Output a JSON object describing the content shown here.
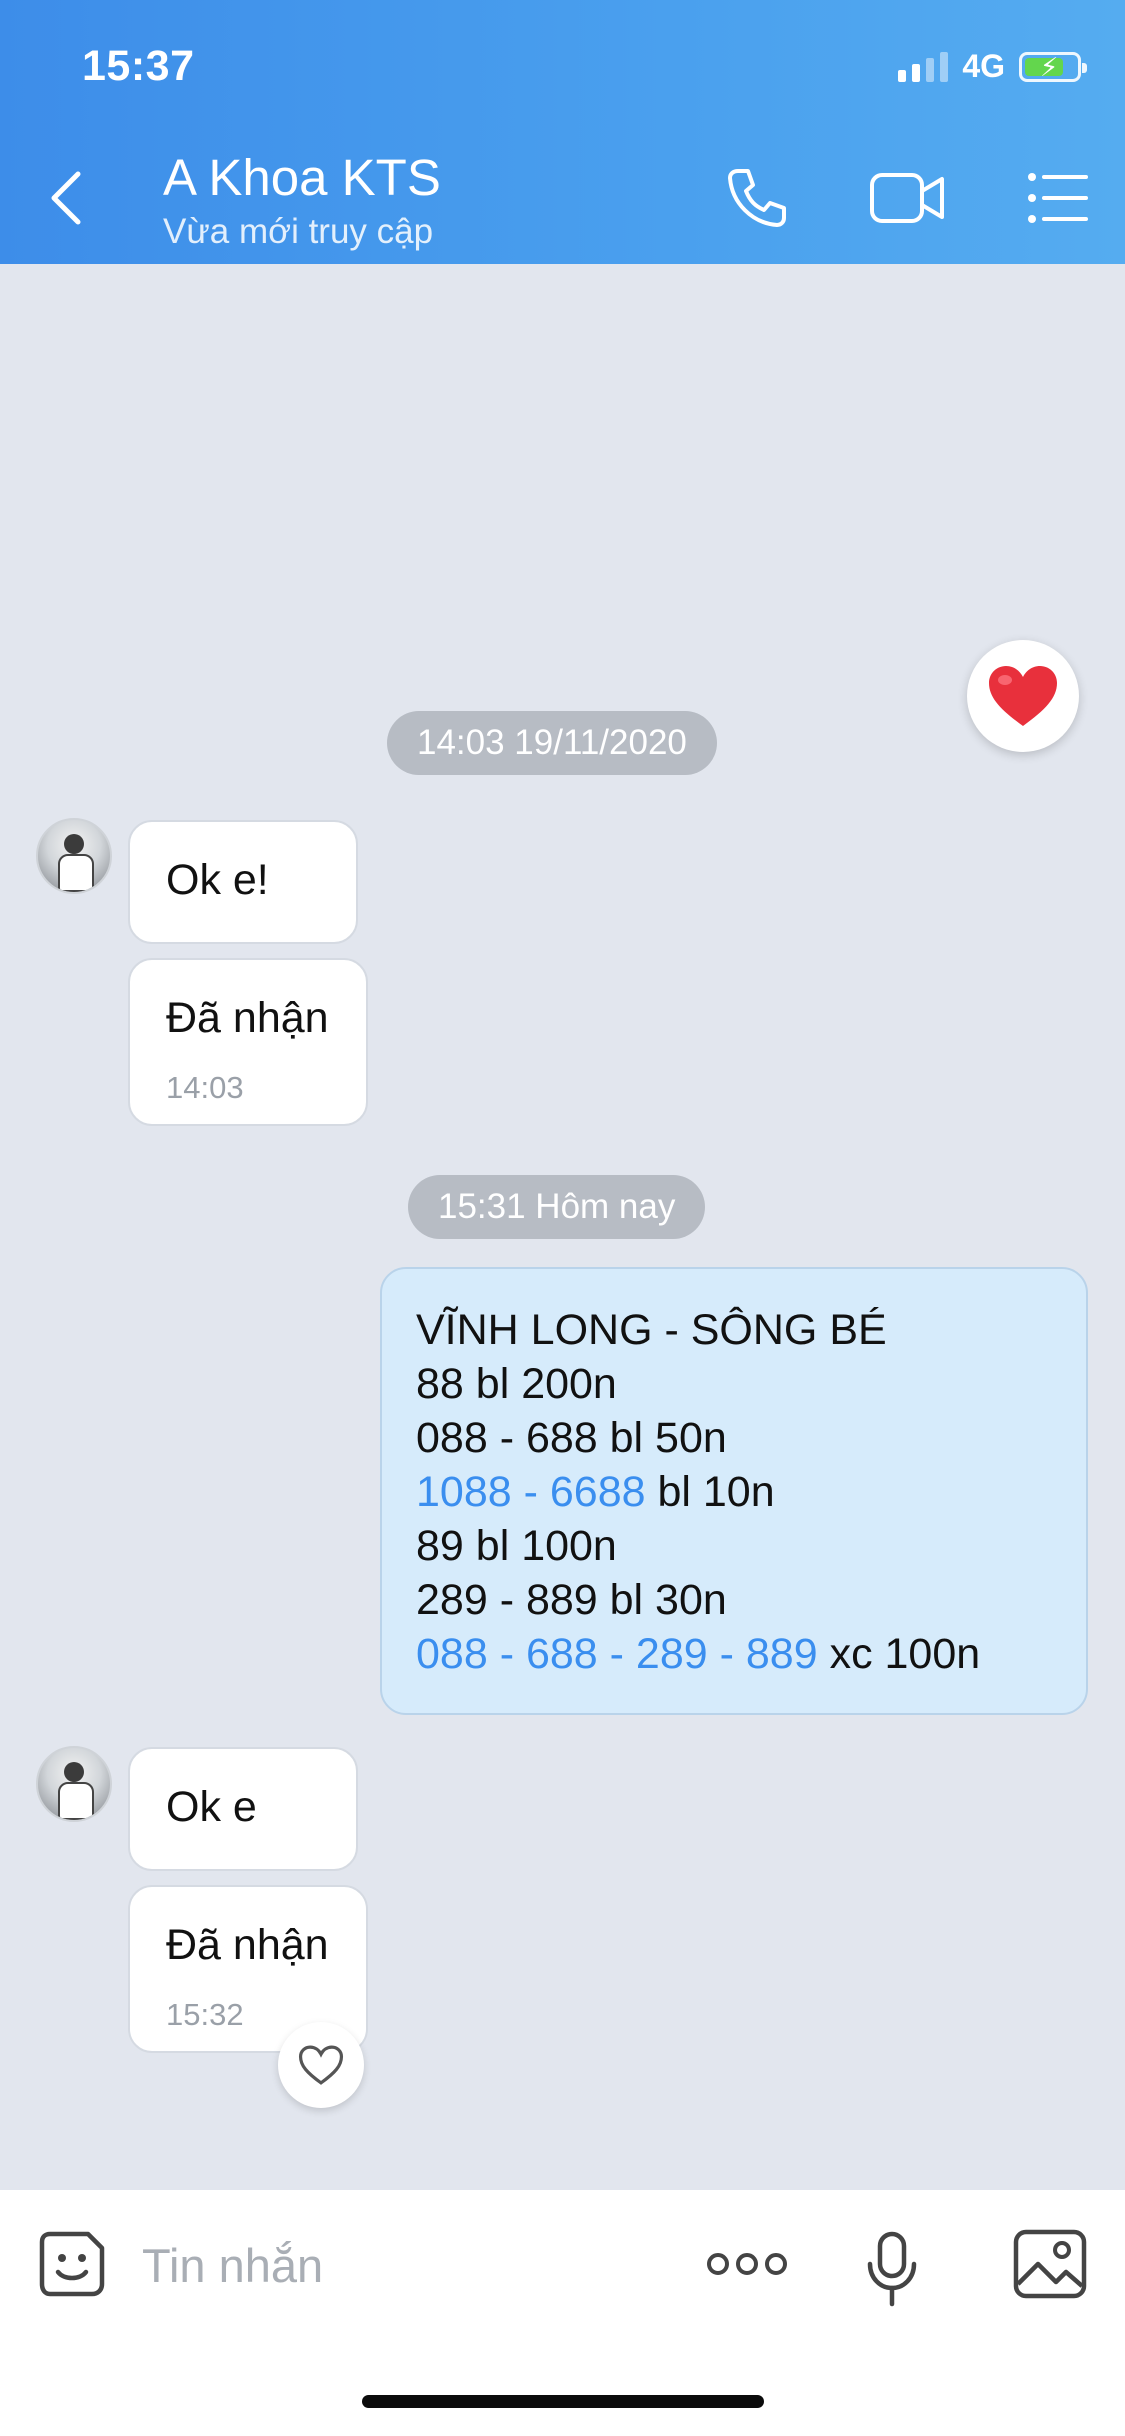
{
  "status_bar": {
    "time": "15:37",
    "network": "4G"
  },
  "header": {
    "title": "A Khoa KTS",
    "subtitle": "Vừa mới truy cập"
  },
  "icons": {
    "back": "chevron-left-icon",
    "call": "phone-icon",
    "video": "video-camera-icon",
    "menu": "list-menu-icon",
    "sticker": "sticker-face-icon",
    "more": "more-dots-icon",
    "mic": "microphone-icon",
    "image": "image-icon",
    "heart": "heart-icon"
  },
  "colors": {
    "header": "#4a9bee",
    "link": "#3a8eef",
    "outgoing_bubble": "#d6ebfb",
    "heart": "#e8303c"
  },
  "messages": {
    "date1": "14:03 19/11/2020",
    "in1_text": "Ok e!",
    "in2_text": "Đã nhận",
    "in2_time": "14:03",
    "date2": "15:31 Hôm nay",
    "out": {
      "line1": "VĨNH LONG - SÔNG BÉ",
      "line2": "88 bl 200n",
      "line3": "088 - 688 bl 50n",
      "line4_link": "1088 - 6688",
      "line4_rest": " bl 10n",
      "line5": "89 bl 100n",
      "line6": "289 - 889 bl 30n",
      "line7_link": "088 - 688 - 289 - 889",
      "line7_rest": " xc 100n"
    },
    "in3_text": "Ok e",
    "in4_text": "Đã nhận",
    "in4_time": "15:32"
  },
  "input": {
    "placeholder": "Tin nhắn"
  }
}
